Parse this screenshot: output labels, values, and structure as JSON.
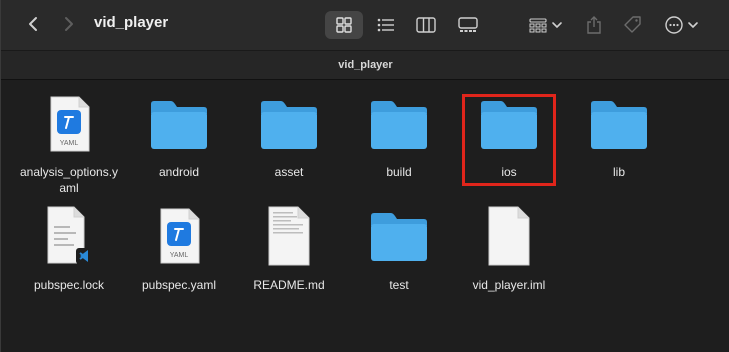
{
  "window": {
    "title": "vid_player",
    "path_label": "vid_player"
  },
  "toolbar": {
    "icons": [
      "back-icon",
      "forward-icon",
      "icon-view-icon",
      "list-view-icon",
      "column-view-icon",
      "gallery-view-icon",
      "group-icon",
      "share-icon",
      "tag-icon",
      "more-actions-icon"
    ],
    "active_view": "icon-view"
  },
  "files": [
    {
      "name": "analysis_options.yaml",
      "display_line1": "analysis_options.y",
      "display_line2": "aml",
      "kind": "yaml"
    },
    {
      "name": "android",
      "kind": "folder"
    },
    {
      "name": "asset",
      "kind": "folder"
    },
    {
      "name": "build",
      "kind": "folder"
    },
    {
      "name": "ios",
      "kind": "folder",
      "highlighted": true
    },
    {
      "name": "lib",
      "kind": "folder"
    },
    {
      "name": "pubspec.lock",
      "kind": "lock"
    },
    {
      "name": "pubspec.yaml",
      "kind": "yaml"
    },
    {
      "name": "README.md",
      "kind": "markdown"
    },
    {
      "name": "test",
      "kind": "folder"
    },
    {
      "name": "vid_player.iml",
      "kind": "document"
    }
  ],
  "colors": {
    "folder": "#4fb0ee",
    "folder_tab": "#3e9ddd",
    "highlight": "#e0251b",
    "yaml_badge": "#1f7ae0",
    "vscode_badge": "#2a8ad8"
  }
}
